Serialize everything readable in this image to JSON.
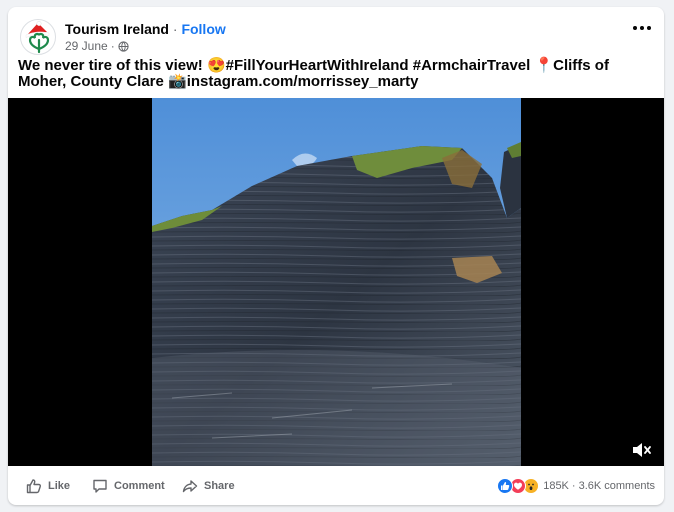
{
  "post": {
    "author": "Tourism Ireland",
    "separator": "·",
    "follow_label": "Follow",
    "date": "29 June",
    "date_separator": "·",
    "audience_icon": "globe-icon",
    "text": "We never tire of this view! 😍#FillYourHeartWithIreland #ArmchairTravel 📍Cliffs of Moher, County Clare 📸instagram.com/morrissey_marty"
  },
  "avatar": {
    "icon": "shamrock-santa-hat-logo",
    "color": "#1e8a4c"
  },
  "video": {
    "mute_icon": "muted-speaker-icon"
  },
  "actions": {
    "like_label": "Like",
    "comment_label": "Comment",
    "share_label": "Share"
  },
  "reactions": {
    "icons": [
      "like-reaction-icon",
      "love-reaction-icon",
      "wow-reaction-icon"
    ],
    "count": "185K",
    "separator": "·",
    "comments": "3.6K comments"
  },
  "colors": {
    "brand": "#1877f2",
    "secondary_text": "#65676b",
    "love": "#f33e58",
    "wow": "#f7b125"
  }
}
